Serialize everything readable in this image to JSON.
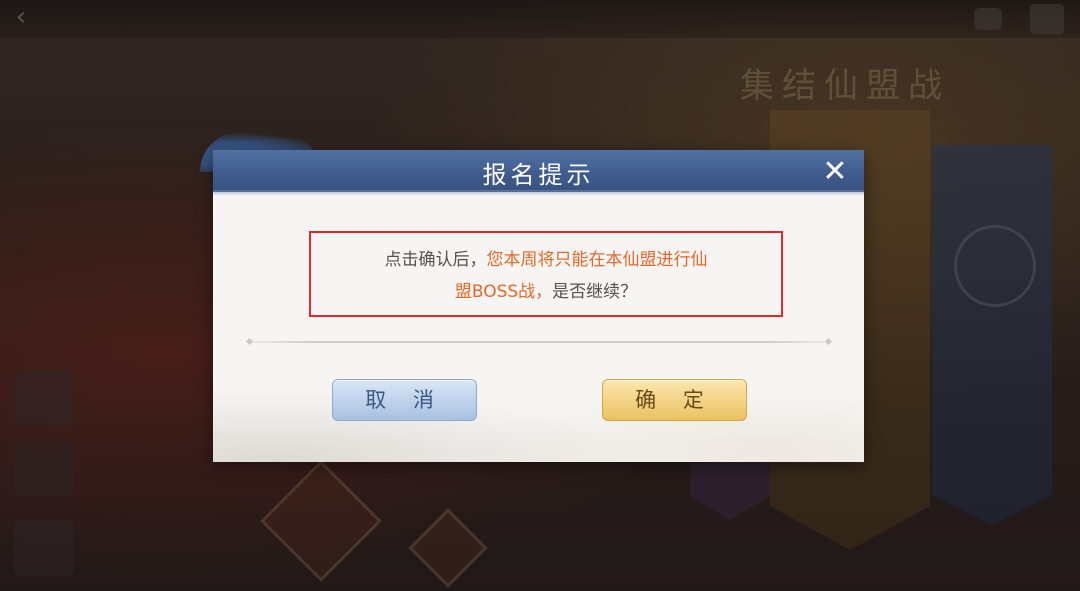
{
  "background": {
    "banner_title": "集结仙盟战"
  },
  "dialog": {
    "title": "报名提示",
    "message_line1_normal": "点击确认后，",
    "message_line1_highlight": "您本周将只能在本仙盟进行仙",
    "message_line2_highlight": "盟BOSS战，",
    "message_line2_normal": "是否继续？",
    "close_icon": "close-icon",
    "cancel_label": "取 消",
    "confirm_label": "确 定"
  },
  "colors": {
    "header_blue": "#3f5b8d",
    "highlight_orange": "#e4682a",
    "box_red": "#e6262a",
    "cancel_blue": "#a8c0e2",
    "confirm_gold": "#ecc161"
  }
}
